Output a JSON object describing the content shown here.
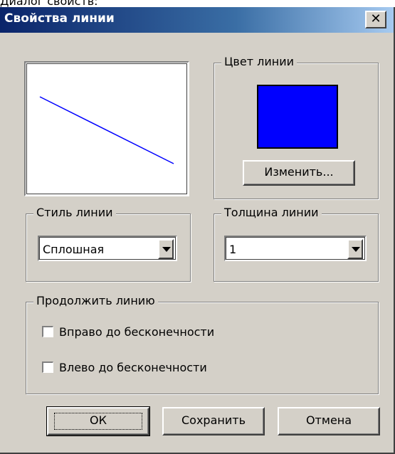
{
  "caption": "Диалог свойств:",
  "window": {
    "title": "Свойства линии"
  },
  "icons": {
    "close": "close-icon",
    "dropdown": "chevron-down-icon"
  },
  "color_group": {
    "label": "Цвет линии",
    "swatch_color": "#0000ff",
    "change_button": "Изменить..."
  },
  "preview": {
    "line_color": "#0000ff"
  },
  "style_group": {
    "label": "Стиль линии",
    "value": "Сплошная"
  },
  "thickness_group": {
    "label": "Толщина линии",
    "value": "1"
  },
  "continue_group": {
    "label": "Продолжить линию",
    "options": [
      {
        "label": "Вправо до бесконечности",
        "checked": false
      },
      {
        "label": "Влево до бесконечности",
        "checked": false
      }
    ]
  },
  "buttons": {
    "ok": "ОК",
    "save": "Сохранить",
    "cancel": "Отмена"
  }
}
